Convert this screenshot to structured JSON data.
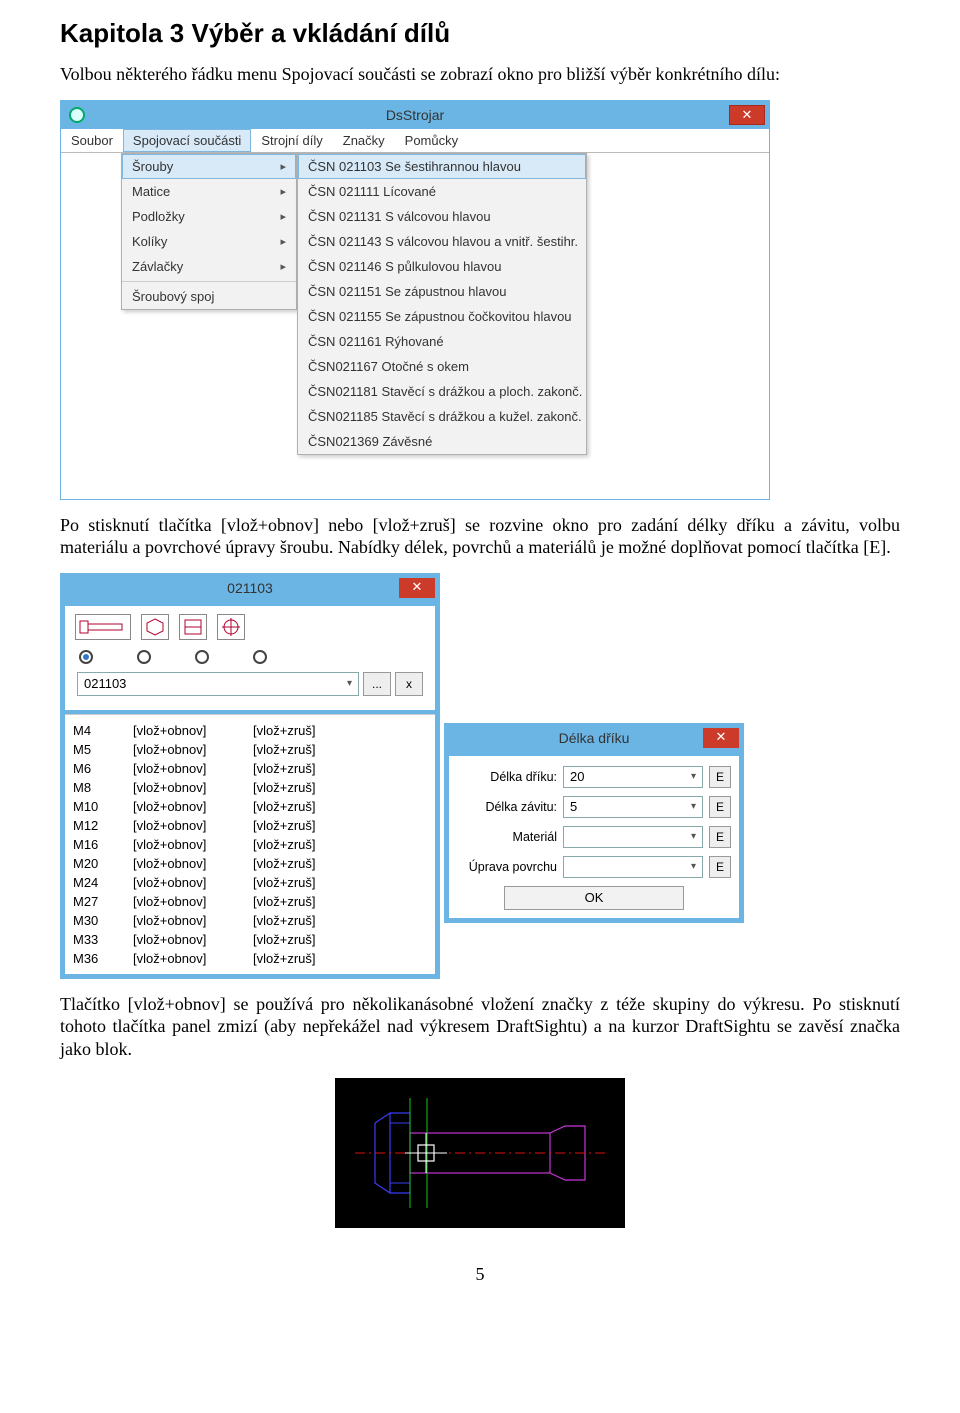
{
  "doc": {
    "heading": "Kapitola 3  Výběr a vkládání dílů",
    "p1": "Volbou některého řádku menu Spojovací součásti se zobrazí okno pro bližší výběr konkrétního dílu:",
    "p2": "Po stisknutí tlačítka [vlož+obnov] nebo [vlož+zruš]  se rozvine okno pro zadání délky dříku a závitu, volbu materiálu a povrchové úpravy šroubu. Nabídky délek, povrchů a materiálů je možné doplňovat pomocí tlačítka [E].",
    "p3": "Tlačítko [vlož+obnov] se používá pro několikanásobné vložení značky z téže skupiny do výkresu. Po stisknutí tohoto tlačítka panel zmizí (aby nepřekážel nad výkresem DraftSightu) a na kurzor DraftSightu se zavěsí značka jako blok.",
    "page_num": "5"
  },
  "win1": {
    "title": "DsStrojar",
    "menu": {
      "file": "Soubor",
      "spoj": "Spojovací součásti",
      "strojni": "Strojní díly",
      "znacky": "Značky",
      "pomucky": "Pomůcky"
    },
    "d1": {
      "srouby": "Šrouby",
      "matice": "Matice",
      "podlozky": "Podložky",
      "koliky": "Kolíky",
      "zavlacky": "Závlačky",
      "sroubspoj": "Šroubový spoj"
    },
    "d2": [
      "ČSN 021103 Se šestihrannou hlavou",
      "ČSN 021111 Lícované",
      "ČSN 021131 S válcovou hlavou",
      "ČSN 021143 S válcovou hlavou a vnitř. šestihr.",
      "ČSN 021146 S půlkulovou hlavou",
      "ČSN 021151 Se zápustnou hlavou",
      "ČSN 021155 Se zápustnou čočkovitou hlavou",
      "ČSN 021161 Rýhované",
      "ČSN021167 Otočné s okem",
      "ČSN021181 Stavěcí s drážkou a ploch. zakonč.",
      "ČSN021185 Stavěcí s drážkou a kužel. zakonč.",
      "ČSN021369 Závěsné"
    ]
  },
  "win2": {
    "title": "021103",
    "combo_value": "021103",
    "dots_btn": "...",
    "x_btn": "x",
    "col2": "[vlož+obnov]",
    "col3": "[vlož+zruš]",
    "rows": [
      "M4",
      "M5",
      "M6",
      "M8",
      "M10",
      "M12",
      "M16",
      "M20",
      "M24",
      "M27",
      "M30",
      "M33",
      "M36"
    ]
  },
  "win3": {
    "title": "Délka dříku",
    "f1_label": "Délka dříku:",
    "f1_value": "20",
    "f2_label": "Délka závitu:",
    "f2_value": "5",
    "f3_label": "Materiál",
    "f4_label": "Úprava povrchu",
    "e_btn": "E",
    "ok": "OK"
  }
}
